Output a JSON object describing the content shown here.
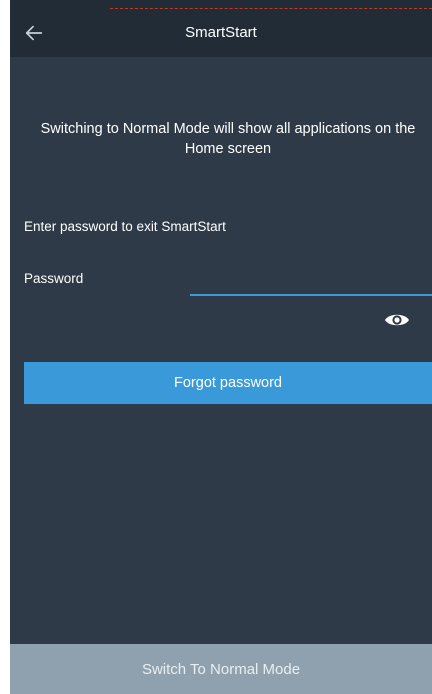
{
  "app_bar": {
    "title": "SmartStart",
    "back_icon": "arrow-left-icon"
  },
  "info_text": "Switching to Normal Mode will show all applications on the Home screen",
  "password_prompt": "Enter password to exit SmartStart",
  "password": {
    "label": "Password",
    "value": "",
    "visibility_icon": "eye-icon"
  },
  "forgot_password_button": "Forgot password",
  "switch_mode_button": "Switch To Normal Mode",
  "colors": {
    "background": "#2e3a47",
    "app_bar": "#222c37",
    "accent": "#3a9ad9",
    "bottom_button": "#8fa1ae"
  }
}
